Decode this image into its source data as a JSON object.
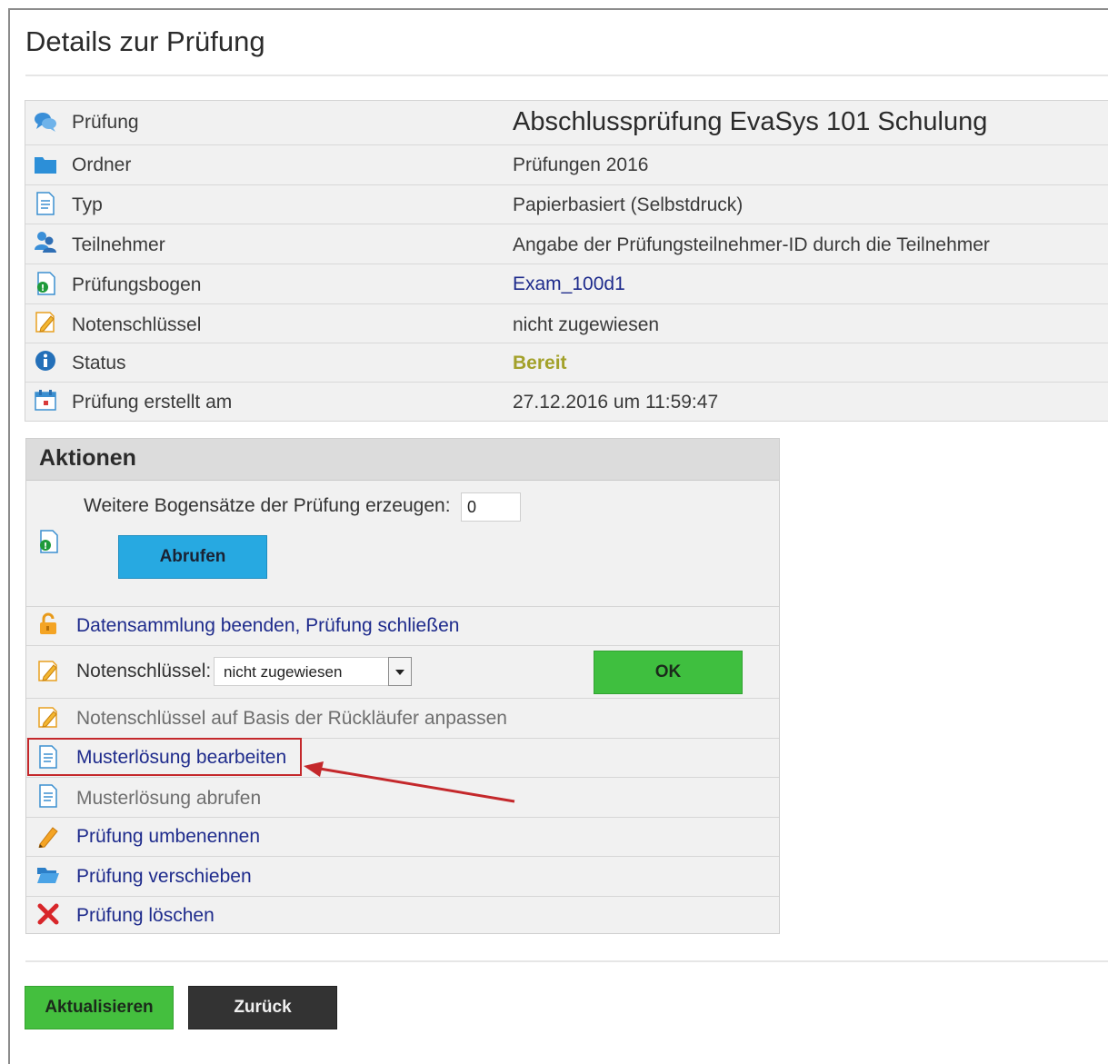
{
  "page": {
    "title": "Details zur Prüfung"
  },
  "details": [
    {
      "label": "Prüfung",
      "value": "Abschlussprüfung EvaSys 101 Schulung",
      "icon": "chat-bubbles-icon"
    },
    {
      "label": "Ordner",
      "value": "Prüfungen 2016",
      "icon": "folder-icon"
    },
    {
      "label": "Typ",
      "value": "Papierbasiert (Selbstdruck)",
      "icon": "document-icon"
    },
    {
      "label": "Teilnehmer",
      "value": "Angabe der Prüfungsteilnehmer-ID durch die Teilnehmer",
      "icon": "users-icon"
    },
    {
      "label": "Prüfungsbogen",
      "value": "Exam_100d1",
      "icon": "exam-sheet-icon"
    },
    {
      "label": "Notenschlüssel",
      "value": "nicht zugewiesen",
      "icon": "edit-document-icon"
    },
    {
      "label": "Status",
      "value": "Bereit",
      "icon": "info-icon"
    },
    {
      "label": "Prüfung erstellt am",
      "value": "27.12.2016 um 11:59:47",
      "icon": "calendar-icon"
    }
  ],
  "actions": {
    "title": "Aktionen",
    "generate_label": "Weitere Bogensätze der Prüfung erzeugen:",
    "generate_value": "0",
    "fetch_button": "Abrufen",
    "close_collection": "Datensammlung beenden, Prüfung schließen",
    "grading_key_label": "Notenschlüssel:",
    "grading_key_selected": "nicht zugewiesen",
    "ok_button": "OK",
    "adjust_key": "Notenschlüssel auf Basis der Rückläufer anpassen",
    "edit_solution": "Musterlösung bearbeiten",
    "fetch_solution": "Musterlösung abrufen",
    "rename": "Prüfung umbenennen",
    "move": "Prüfung verschieben",
    "delete": "Prüfung löschen"
  },
  "footer": {
    "refresh_button": "Aktualisieren",
    "back_button": "Zurück"
  },
  "colors": {
    "link": "#1e2b8c",
    "status_ready": "#a3a12a",
    "fetch_button": "#27a9e1",
    "ok_button": "#3fbf3f",
    "refresh_button": "#44bf3e",
    "back_button": "#333333",
    "highlight": "#c4282b"
  }
}
